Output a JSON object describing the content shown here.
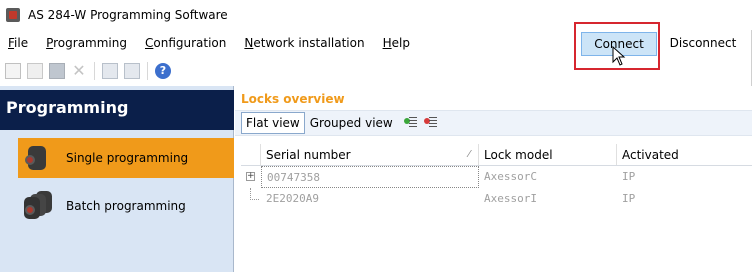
{
  "window": {
    "title": "AS 284-W Programming Software"
  },
  "menu": {
    "items": [
      {
        "label": "File",
        "accel": "F",
        "rest": "ile"
      },
      {
        "label": "Programming",
        "accel": "P",
        "rest": "rogramming"
      },
      {
        "label": "Configuration",
        "accel": "C",
        "rest": "onfiguration"
      },
      {
        "label": "Network installation",
        "accel": "N",
        "rest": "etwork installation"
      },
      {
        "label": "Help",
        "accel": "H",
        "rest": "elp"
      }
    ],
    "connect_label": "Connect",
    "disconnect_label": "Disconnect"
  },
  "toolbar": {
    "icons": [
      "new-document-icon",
      "open-folder-icon",
      "save-icon",
      "delete-icon",
      "download-icon",
      "upload-icon",
      "help-icon"
    ]
  },
  "sidebar": {
    "header": "Programming",
    "items": [
      {
        "label": "Single programming",
        "active": true
      },
      {
        "label": "Batch programming",
        "active": false
      }
    ]
  },
  "main": {
    "title": "Locks overview",
    "tabs": [
      {
        "label": "Flat view",
        "active": true
      },
      {
        "label": "Grouped view",
        "active": false
      }
    ],
    "columns": [
      "Serial number",
      "Lock model",
      "Activated"
    ],
    "rows": [
      {
        "serial": "00747358",
        "model": "AxessorC",
        "activated": "IP"
      },
      {
        "serial": "2E2020A9",
        "model": "AxessorI",
        "activated": "IP"
      }
    ]
  },
  "colors": {
    "accent_orange": "#f09a1a",
    "sidebar_header": "#0b1f4a",
    "sidebar_bg": "#d9e5f4",
    "highlight_red": "#d6262f"
  }
}
